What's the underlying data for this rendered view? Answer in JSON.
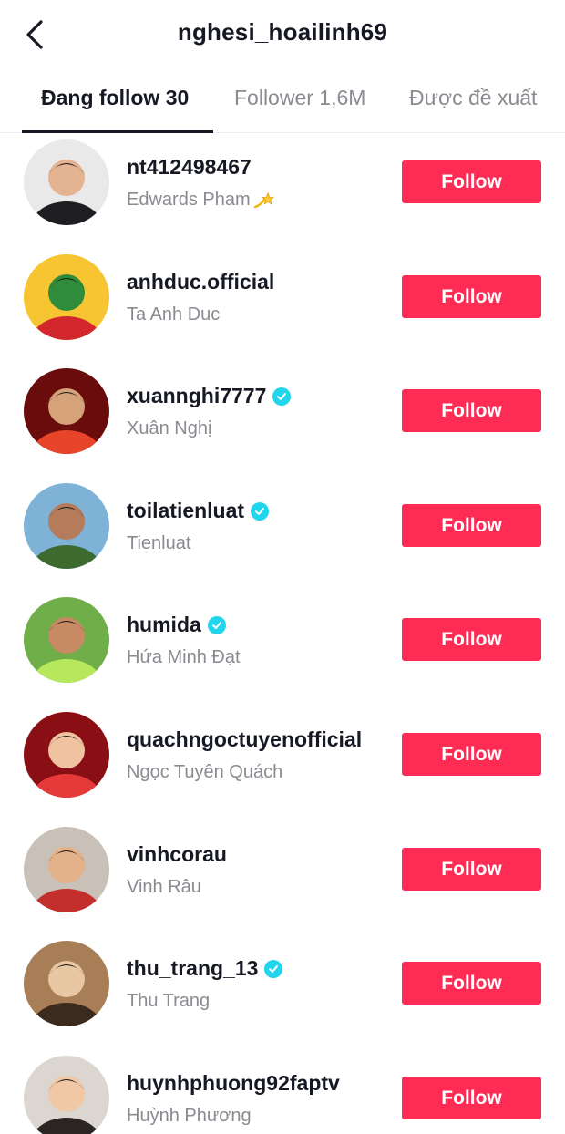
{
  "header": {
    "title": "nghesi_hoailinh69",
    "back_icon": "chevron-left-icon"
  },
  "tabs": [
    {
      "label": "Đang follow 30",
      "active": true
    },
    {
      "label": "Follower 1,6M",
      "active": false
    },
    {
      "label": "Được đề xuất",
      "active": false
    }
  ],
  "colors": {
    "follow_button": "#fe2c55",
    "verified_badge": "#20d5ec",
    "primary_text": "#161823",
    "secondary_text": "#8a8b91"
  },
  "users": [
    {
      "username": "nt412498467",
      "display_name": "Edwards Pham",
      "verified": false,
      "emoji": "dizzy-icon",
      "follow_label": "Follow"
    },
    {
      "username": "anhduc.official",
      "display_name": "Ta Anh Duc",
      "verified": false,
      "follow_label": "Follow"
    },
    {
      "username": "xuannghi7777",
      "display_name": "Xuân Nghị",
      "verified": true,
      "follow_label": "Follow"
    },
    {
      "username": "toilatienluat",
      "display_name": "Tienluat",
      "verified": true,
      "follow_label": "Follow"
    },
    {
      "username": "humida",
      "display_name": "Hứa Minh Đạt",
      "verified": true,
      "follow_label": "Follow"
    },
    {
      "username": "quachngoctuyenofficial",
      "display_name": "Ngọc Tuyên Quách",
      "verified": false,
      "follow_label": "Follow"
    },
    {
      "username": "vinhcorau",
      "display_name": "Vinh Râu",
      "verified": false,
      "follow_label": "Follow"
    },
    {
      "username": "thu_trang_13",
      "display_name": "Thu Trang",
      "verified": true,
      "follow_label": "Follow"
    },
    {
      "username": "huynhphuong92faptv",
      "display_name": "Huỳnh Phương",
      "verified": false,
      "follow_label": "Follow"
    }
  ]
}
